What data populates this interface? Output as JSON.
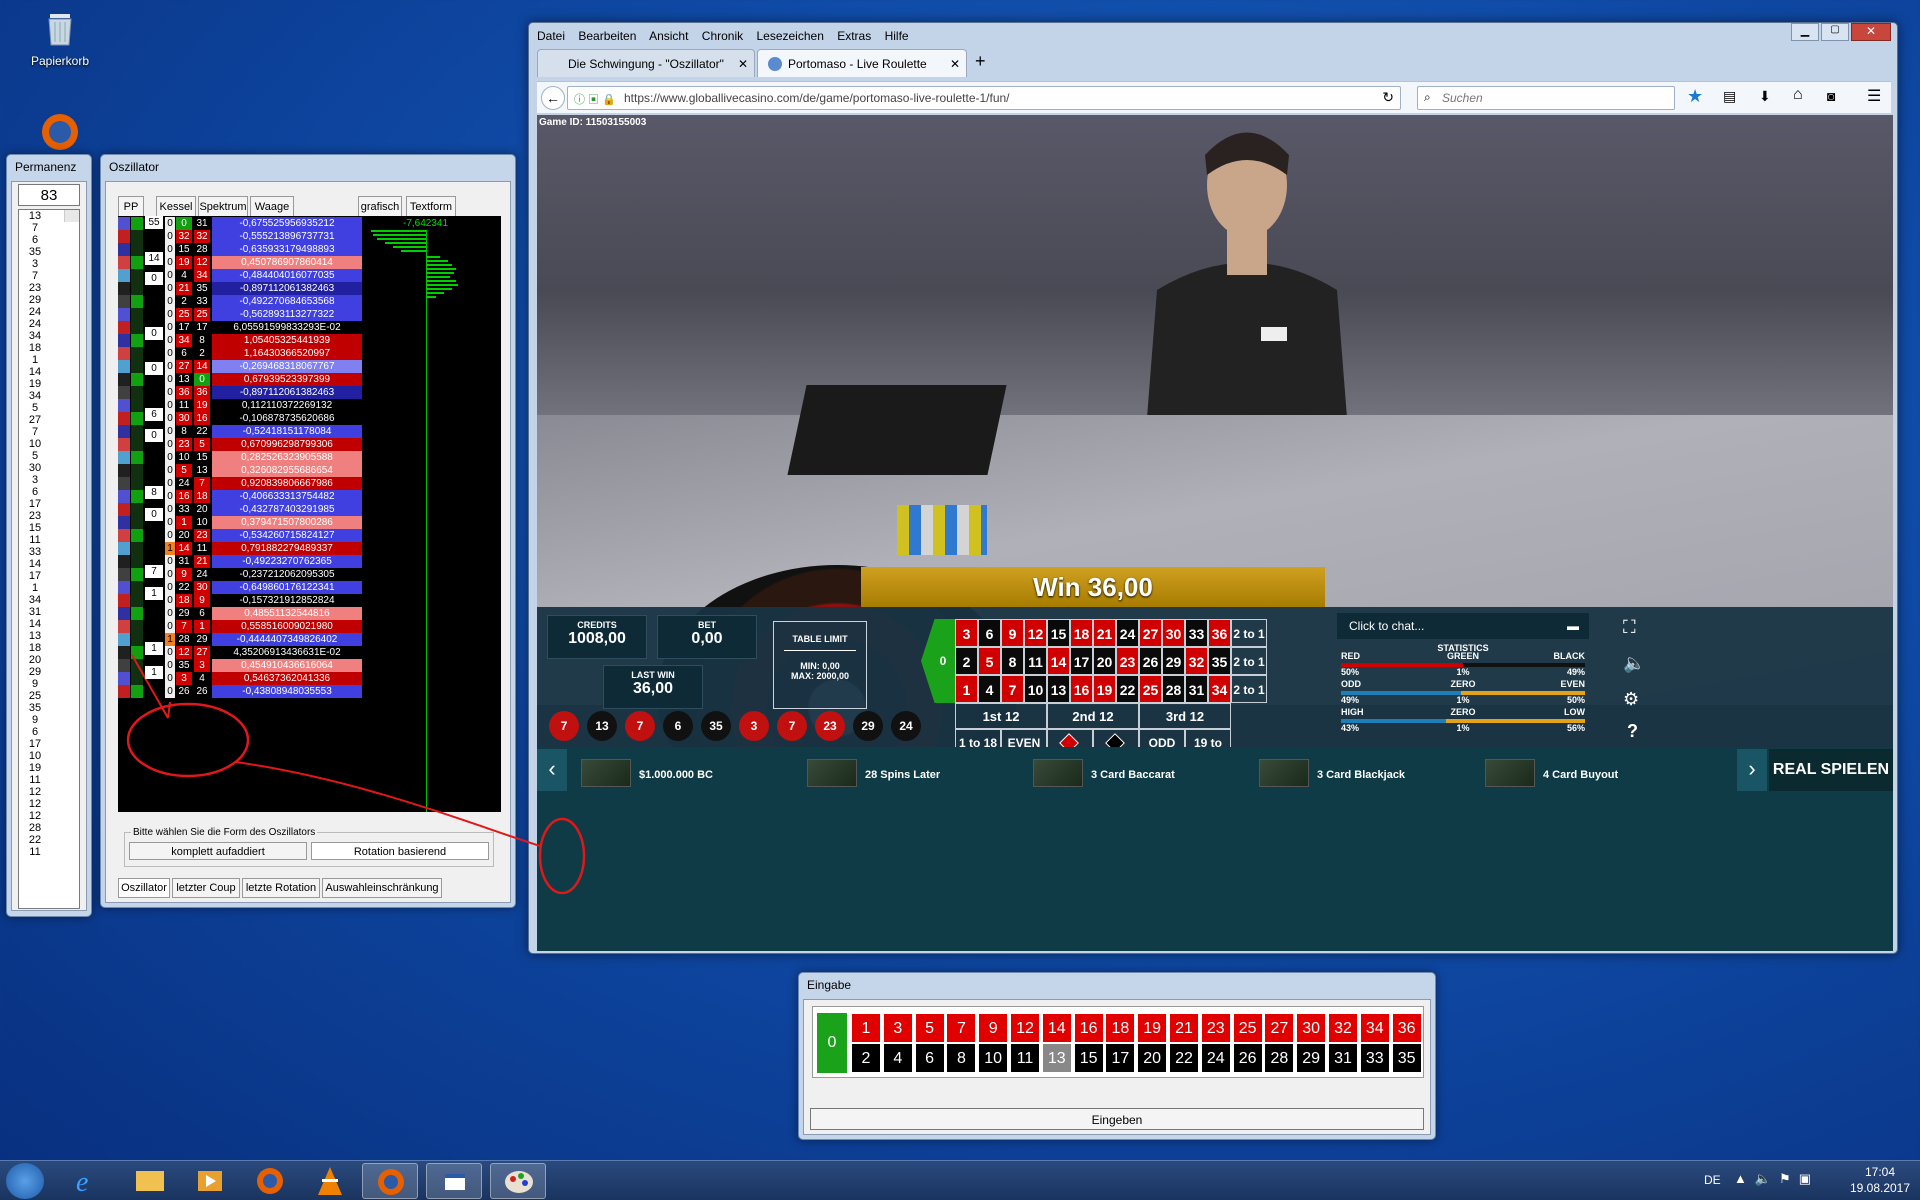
{
  "desktop": {
    "recycle_bin_label": "Papierkorb"
  },
  "permanenz": {
    "title": "Permanenz",
    "count": "83",
    "numbers": [
      "13",
      "7",
      "6",
      "35",
      "3",
      "7",
      "23",
      "29",
      "24",
      "24",
      "34",
      "18",
      "1",
      "14",
      "19",
      "34",
      "5",
      "27",
      "7",
      "10",
      "5",
      "30",
      "3",
      "6",
      "17",
      "23",
      "15",
      "11",
      "33",
      "14",
      "17",
      "1",
      "34",
      "31",
      "14",
      "13",
      "18",
      "20",
      "29",
      "9",
      "25",
      "35",
      "9",
      "6",
      "17",
      "10",
      "19",
      "11",
      "12",
      "12",
      "12",
      "28",
      "22",
      "11"
    ]
  },
  "oszillator": {
    "title": "Oszillator",
    "headers": {
      "pp": "PP",
      "kessel": "Kessel",
      "spektrum": "Spektrum",
      "waage": "Waage",
      "grafisch": "grafisch",
      "textform": "Textform"
    },
    "grafisch_value": "-7,642341",
    "rows": [
      {
        "a": "0",
        "b": "0",
        "c": "31",
        "v": "-0,675525956935212",
        "vc": "#4040e0"
      },
      {
        "a": "0",
        "b": "32",
        "c": "32",
        "v": "-0,555213896737731",
        "vc": "#4040e0"
      },
      {
        "a": "0",
        "b": "15",
        "c": "28",
        "v": "-0,635933179498893",
        "vc": "#4040e0"
      },
      {
        "a": "0",
        "b": "19",
        "c": "12",
        "v": "0,450786907860414",
        "vc": "#f08080"
      },
      {
        "a": "0",
        "b": "4",
        "c": "34",
        "v": "-0,484404016077035",
        "vc": "#4040e0"
      },
      {
        "a": "0",
        "b": "21",
        "c": "35",
        "v": "-0,897112061382463",
        "vc": "#2020a0"
      },
      {
        "a": "0",
        "b": "2",
        "c": "33",
        "v": "-0,492270684653568",
        "vc": "#4040e0"
      },
      {
        "a": "0",
        "b": "25",
        "c": "25",
        "v": "-0,562893113277322",
        "vc": "#4040e0"
      },
      {
        "a": "0",
        "b": "17",
        "c": "17",
        "v": "6,05591599833293E-02",
        "vc": "#000000"
      },
      {
        "a": "0",
        "b": "34",
        "c": "8",
        "v": "1,05405325441939",
        "vc": "#c00000"
      },
      {
        "a": "0",
        "b": "6",
        "c": "2",
        "v": "1,16430366520997",
        "vc": "#c00000"
      },
      {
        "a": "0",
        "b": "27",
        "c": "14",
        "v": "-0,269468318067767",
        "vc": "#8080f0"
      },
      {
        "a": "0",
        "b": "13",
        "c": "0",
        "v": "0,67939523397399",
        "vc": "#c00000"
      },
      {
        "a": "0",
        "b": "36",
        "c": "36",
        "v": "-0,897112061382463",
        "vc": "#2020a0"
      },
      {
        "a": "0",
        "b": "11",
        "c": "19",
        "v": "0,112110372269132",
        "vc": "#000000"
      },
      {
        "a": "0",
        "b": "30",
        "c": "16",
        "v": "-0,106878735620686",
        "vc": "#000000"
      },
      {
        "a": "0",
        "b": "8",
        "c": "22",
        "v": "-0,52418151178084",
        "vc": "#4040e0"
      },
      {
        "a": "0",
        "b": "23",
        "c": "5",
        "v": "0,670996298799306",
        "vc": "#c00000"
      },
      {
        "a": "0",
        "b": "10",
        "c": "15",
        "v": "0,282526323905588",
        "vc": "#f08080"
      },
      {
        "a": "0",
        "b": "5",
        "c": "13",
        "v": "0,326082955686654",
        "vc": "#f08080"
      },
      {
        "a": "0",
        "b": "24",
        "c": "7",
        "v": "0,920839806667986",
        "vc": "#c00000"
      },
      {
        "a": "0",
        "b": "16",
        "c": "18",
        "v": "-0,406633313754482",
        "vc": "#4040e0"
      },
      {
        "a": "0",
        "b": "33",
        "c": "20",
        "v": "-0,432787403291985",
        "vc": "#4040e0"
      },
      {
        "a": "0",
        "b": "1",
        "c": "10",
        "v": "0,379471507800286",
        "vc": "#f08080"
      },
      {
        "a": "0",
        "b": "20",
        "c": "23",
        "v": "-0,534260715824127",
        "vc": "#4040e0"
      },
      {
        "a": "1",
        "b": "14",
        "c": "11",
        "v": "0,791882279489337",
        "vc": "#c00000"
      },
      {
        "a": "0",
        "b": "31",
        "c": "21",
        "v": "-0,49223270762365",
        "vc": "#4040e0"
      },
      {
        "a": "0",
        "b": "9",
        "c": "24",
        "v": "-0,237212062095305",
        "vc": "#000000"
      },
      {
        "a": "0",
        "b": "22",
        "c": "30",
        "v": "-0,649860176122341",
        "vc": "#4040e0"
      },
      {
        "a": "0",
        "b": "18",
        "c": "9",
        "v": "-0,157321912852824",
        "vc": "#000000"
      },
      {
        "a": "0",
        "b": "29",
        "c": "6",
        "v": "0,48551132544816",
        "vc": "#f08080"
      },
      {
        "a": "0",
        "b": "7",
        "c": "1",
        "v": "0,558516009021980",
        "vc": "#c00000"
      },
      {
        "a": "1",
        "b": "28",
        "c": "29",
        "v": "-0,4444407349826402",
        "vc": "#4040e0"
      },
      {
        "a": "0",
        "b": "12",
        "c": "27",
        "v": "4,35206913436631E-02",
        "vc": "#000000"
      },
      {
        "a": "0",
        "b": "35",
        "c": "3",
        "v": "0,454910436616064",
        "vc": "#f08080"
      },
      {
        "a": "0",
        "b": "3",
        "c": "4",
        "v": "0,54637362041336",
        "vc": "#c00000"
      },
      {
        "a": "0",
        "b": "26",
        "c": "26",
        "v": "-0,43808948035553",
        "vc": "#4040e0"
      }
    ],
    "kessel_numbers": [
      "55",
      "14",
      "0",
      "0",
      "0",
      "6",
      "0",
      "8",
      "0",
      "7",
      "1",
      "1",
      "1"
    ],
    "form_label": "Bitte wählen Sie die Form des Oszillators",
    "form_btn1": "komplett aufaddiert",
    "form_btn2": "Rotation basierend",
    "bottom_tabs": [
      "Oszillator",
      "letzter Coup",
      "letzte Rotation",
      "Auswahleinschränkung"
    ]
  },
  "browser": {
    "menu": [
      "Datei",
      "Bearbeiten",
      "Ansicht",
      "Chronik",
      "Lesezeichen",
      "Extras",
      "Hilfe"
    ],
    "tab1": "Die Schwingung - \"Oszillator\"",
    "tab2": "Portomaso - Live Roulette",
    "url": "https://www.globallivecasino.com/de/game/portomaso-live-roulette-1/fun/",
    "search_placeholder": "Suchen",
    "game_id": "Game ID: 11503155003"
  },
  "game": {
    "win_banner": "Win 36,00",
    "credits_label": "CREDITS",
    "credits": "1008,00",
    "bet_label": "BET",
    "bet": "0,00",
    "lastwin_label": "LAST WIN",
    "lastwin": "36,00",
    "limit_label": "TABLE LIMIT",
    "limit_min": "MIN: 0,00",
    "limit_max": "MAX: 2000,00",
    "history": [
      {
        "n": "7",
        "c": "red"
      },
      {
        "n": "13",
        "c": "black"
      },
      {
        "n": "7",
        "c": "red"
      },
      {
        "n": "6",
        "c": "black"
      },
      {
        "n": "35",
        "c": "black"
      },
      {
        "n": "3",
        "c": "red"
      },
      {
        "n": "7",
        "c": "red"
      },
      {
        "n": "23",
        "c": "red"
      },
      {
        "n": "29",
        "c": "black"
      },
      {
        "n": "24",
        "c": "black"
      }
    ],
    "zero": "0",
    "table_rows": [
      [
        "3",
        "6",
        "9",
        "12",
        "15",
        "18",
        "21",
        "24",
        "27",
        "30",
        "33",
        "36"
      ],
      [
        "2",
        "5",
        "8",
        "11",
        "14",
        "17",
        "20",
        "23",
        "26",
        "29",
        "32",
        "35"
      ],
      [
        "1",
        "4",
        "7",
        "10",
        "13",
        "16",
        "19",
        "22",
        "25",
        "28",
        "31",
        "34"
      ]
    ],
    "table_colors": [
      [
        "r",
        "b",
        "r",
        "r",
        "b",
        "r",
        "r",
        "b",
        "r",
        "r",
        "b",
        "r"
      ],
      [
        "b",
        "r",
        "b",
        "b",
        "r",
        "b",
        "b",
        "r",
        "b",
        "b",
        "r",
        "b"
      ],
      [
        "r",
        "b",
        "r",
        "b",
        "b",
        "r",
        "r",
        "b",
        "r",
        "b",
        "b",
        "r"
      ]
    ],
    "column_bets": [
      "2 to 1",
      "2 to 1",
      "2 to 1"
    ],
    "dozens": [
      "1st 12",
      "2nd 12",
      "3rd 12"
    ],
    "outside": [
      "1 to 18",
      "EVEN",
      "ODD",
      "19 to 36"
    ],
    "chat_placeholder": "Click to chat...",
    "stats_title": "STATISTICS",
    "stats": [
      {
        "l": "RED",
        "m": "GREEN",
        "r": "BLACK",
        "lv": "50%",
        "mv": "1%",
        "rv": "49%",
        "lc": "#d00000",
        "rc": "#111111"
      },
      {
        "l": "ODD",
        "m": "ZERO",
        "r": "EVEN",
        "lv": "49%",
        "mv": "1%",
        "rv": "50%",
        "lc": "#1e7fb8",
        "rc": "#e3a21a"
      },
      {
        "l": "HIGH",
        "m": "ZERO",
        "r": "LOW",
        "lv": "43%",
        "mv": "1%",
        "rv": "56%",
        "lc": "#1e7fb8",
        "rc": "#e3a21a"
      }
    ],
    "lobby": [
      {
        "name": "$1.000.000 BC"
      },
      {
        "name": "28 Spins Later"
      },
      {
        "name": "3 Card Baccarat"
      },
      {
        "name": "3 Card Blackjack"
      },
      {
        "name": "4 Card Buyout"
      }
    ],
    "real_button": "REAL SPIELEN"
  },
  "eingabe": {
    "title": "Eingabe",
    "zero": "0",
    "top": [
      "1",
      "3",
      "5",
      "7",
      "9",
      "12",
      "14",
      "16",
      "18",
      "19",
      "21",
      "23",
      "25",
      "27",
      "30",
      "32",
      "34",
      "36"
    ],
    "bottom": [
      "2",
      "4",
      "6",
      "8",
      "10",
      "11",
      "13",
      "15",
      "17",
      "20",
      "22",
      "24",
      "26",
      "28",
      "29",
      "31",
      "33",
      "35"
    ],
    "button": "Eingeben"
  },
  "taskbar": {
    "lang": "DE",
    "time": "17:04",
    "date": "19.08.2017"
  }
}
